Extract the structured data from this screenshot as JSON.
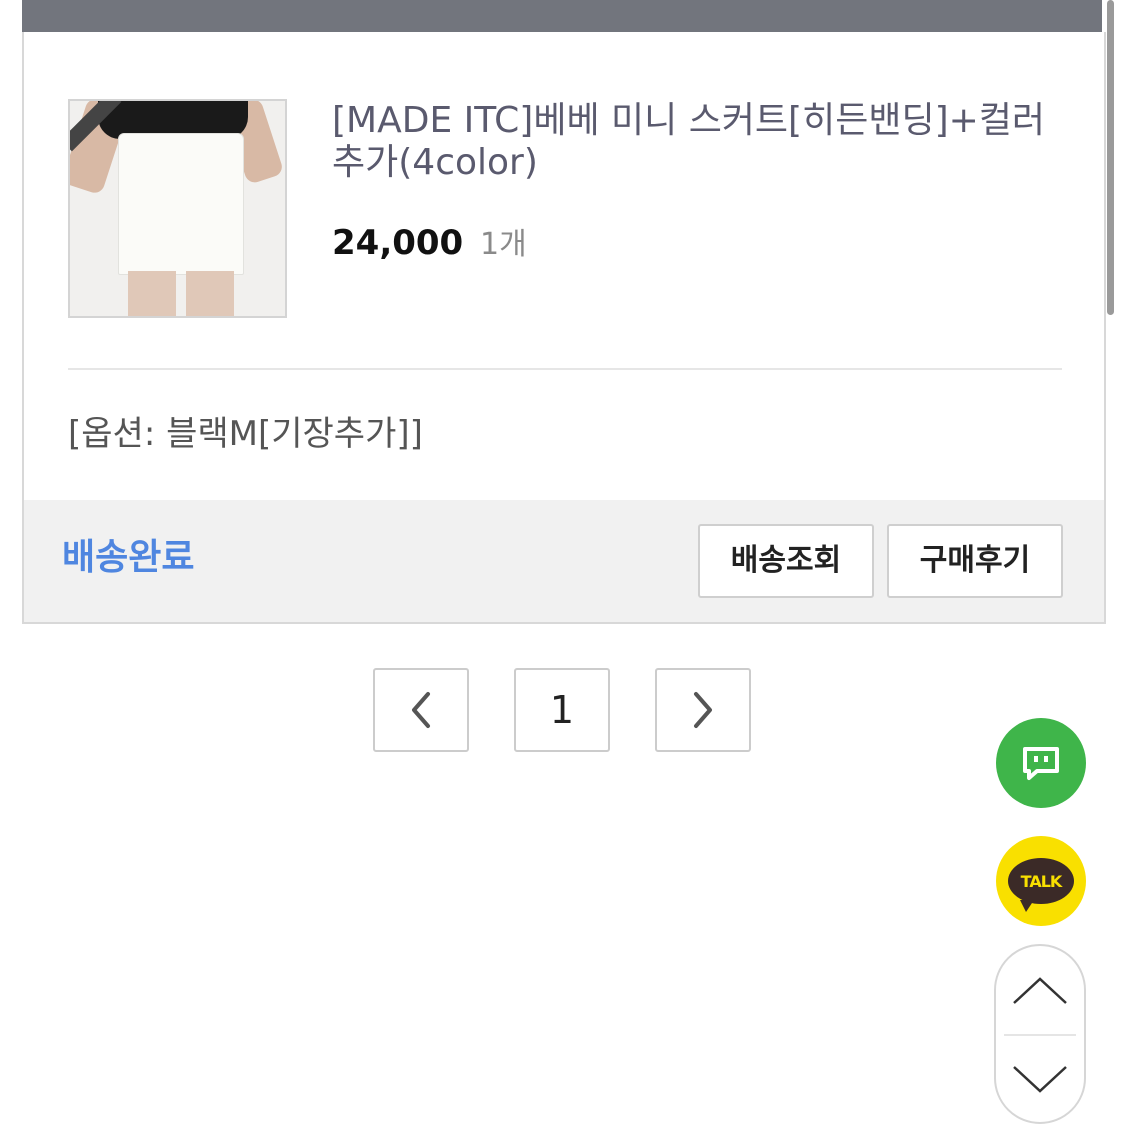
{
  "order": {
    "product_title": "[MADE ITC]베베 미니 스커트[히든밴딩]+컬러추가(4color)",
    "price": "24,000",
    "quantity": "1개",
    "option": "[옵션: 블랙M[기장추가]]",
    "status": "배송완료",
    "track_button": "배송조회",
    "review_button": "구매후기",
    "thumbnail_icon": "product-thumbnail-image"
  },
  "pagination": {
    "current_page": "1",
    "prev_icon": "chevron-left-icon",
    "next_icon": "chevron-right-icon"
  },
  "floating": {
    "chat_icon": "chat-icon",
    "talk_label": "TALK",
    "scroll_up_icon": "chevron-up-icon",
    "scroll_down_icon": "chevron-down-icon"
  },
  "colors": {
    "status_blue": "#4f86e0",
    "chat_green": "#3fb54a",
    "kakao_yellow": "#f9e000",
    "top_bar": "#72757d"
  }
}
